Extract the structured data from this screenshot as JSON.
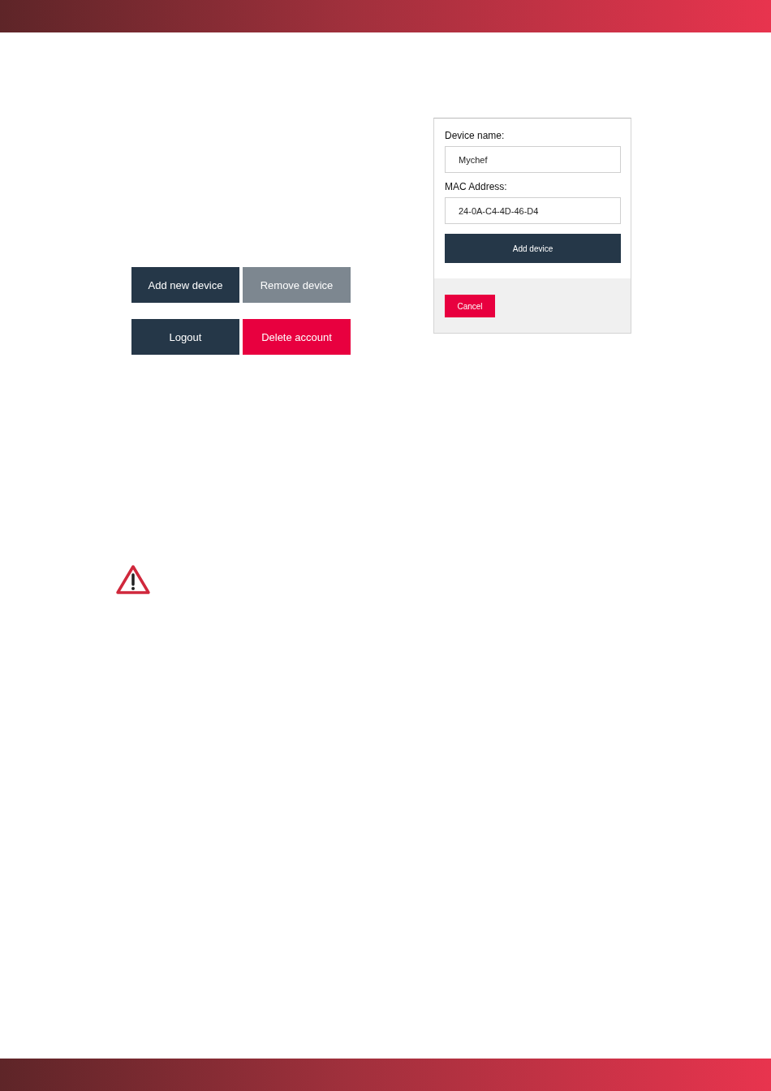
{
  "buttons": [
    {
      "label": "Add new device",
      "kind": "primary"
    },
    {
      "label": "Remove device",
      "kind": "muted"
    },
    {
      "label": "Logout",
      "kind": "primary"
    },
    {
      "label": "Delete account",
      "kind": "danger"
    }
  ],
  "dialog": {
    "fields": [
      {
        "label": "Device name:",
        "value": "Mychef"
      },
      {
        "label": "MAC Address:",
        "value": "24-0A-C4-4D-46-D4"
      }
    ],
    "submit": "Add device",
    "cancel": "Cancel"
  }
}
